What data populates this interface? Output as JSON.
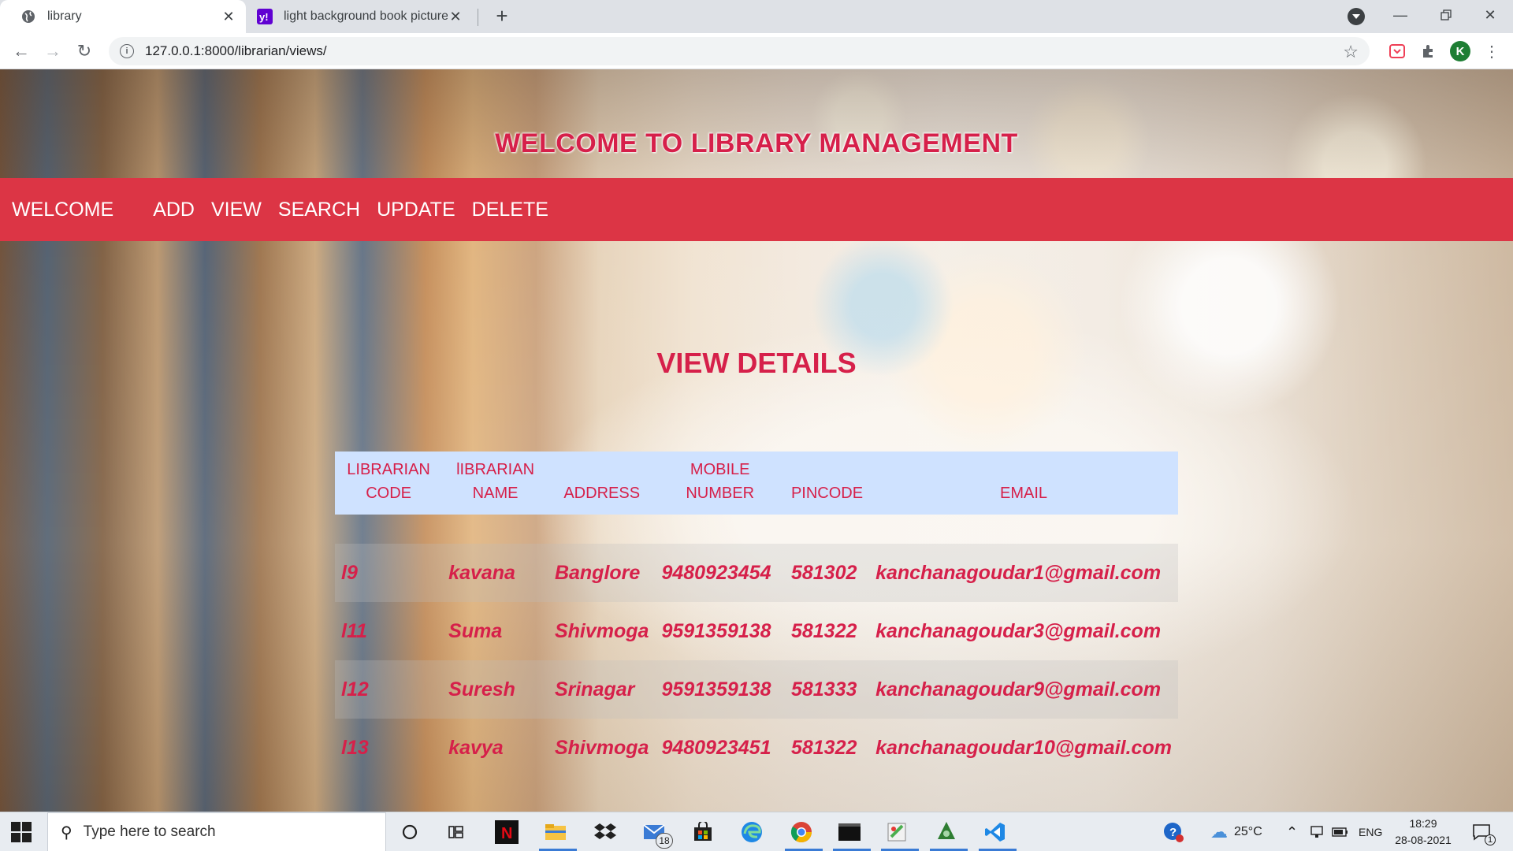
{
  "browser": {
    "tabs": [
      {
        "title": "library",
        "active": true
      },
      {
        "title": "light background book pictures -",
        "active": false
      }
    ],
    "url": "127.0.0.1:8000/librarian/views/",
    "profile_initial": "K"
  },
  "page": {
    "hero_title": "WELCOME TO LIBRARY MANAGEMENT",
    "nav": {
      "brand": "WELCOME",
      "links": [
        "ADD",
        "VIEW",
        "SEARCH",
        "UPDATE",
        "DELETE"
      ]
    },
    "section_title": "VIEW DETAILS",
    "table": {
      "headers": [
        {
          "line1": "LIBRARIAN",
          "line2": "CODE"
        },
        {
          "line1": "lIBRARIAN",
          "line2": "NAME"
        },
        {
          "line1": "",
          "line2": "ADDRESS"
        },
        {
          "line1": "MOBILE",
          "line2": "NUMBER"
        },
        {
          "line1": "",
          "line2": "PINCODE"
        },
        {
          "line1": "",
          "line2": "EMAIL"
        }
      ],
      "rows": [
        {
          "code": "l9",
          "name": "kavana",
          "address": "Banglore",
          "mobile": "9480923454",
          "pincode": "581302",
          "email": "kanchanagoudar1@gmail.com"
        },
        {
          "code": "l11",
          "name": "Suma",
          "address": "Shivmoga",
          "mobile": "9591359138",
          "pincode": "581322",
          "email": "kanchanagoudar3@gmail.com"
        },
        {
          "code": "l12",
          "name": "Suresh",
          "address": "Srinagar",
          "mobile": "9591359138",
          "pincode": "581333",
          "email": "kanchanagoudar9@gmail.com"
        },
        {
          "code": "l13",
          "name": "kavya",
          "address": "Shivmoga",
          "mobile": "9480923451",
          "pincode": "581322",
          "email": "kanchanagoudar10@gmail.com"
        }
      ]
    },
    "colors": {
      "accent": "#dc3545",
      "text_red": "#d6204a",
      "header_bg": "#cfe2ff"
    }
  },
  "taskbar": {
    "search_placeholder": "Type here to search",
    "mail_badge": "18",
    "weather": "25°C",
    "language": "ENG",
    "time": "18:29",
    "date": "28-08-2021",
    "notification_count": "1"
  }
}
